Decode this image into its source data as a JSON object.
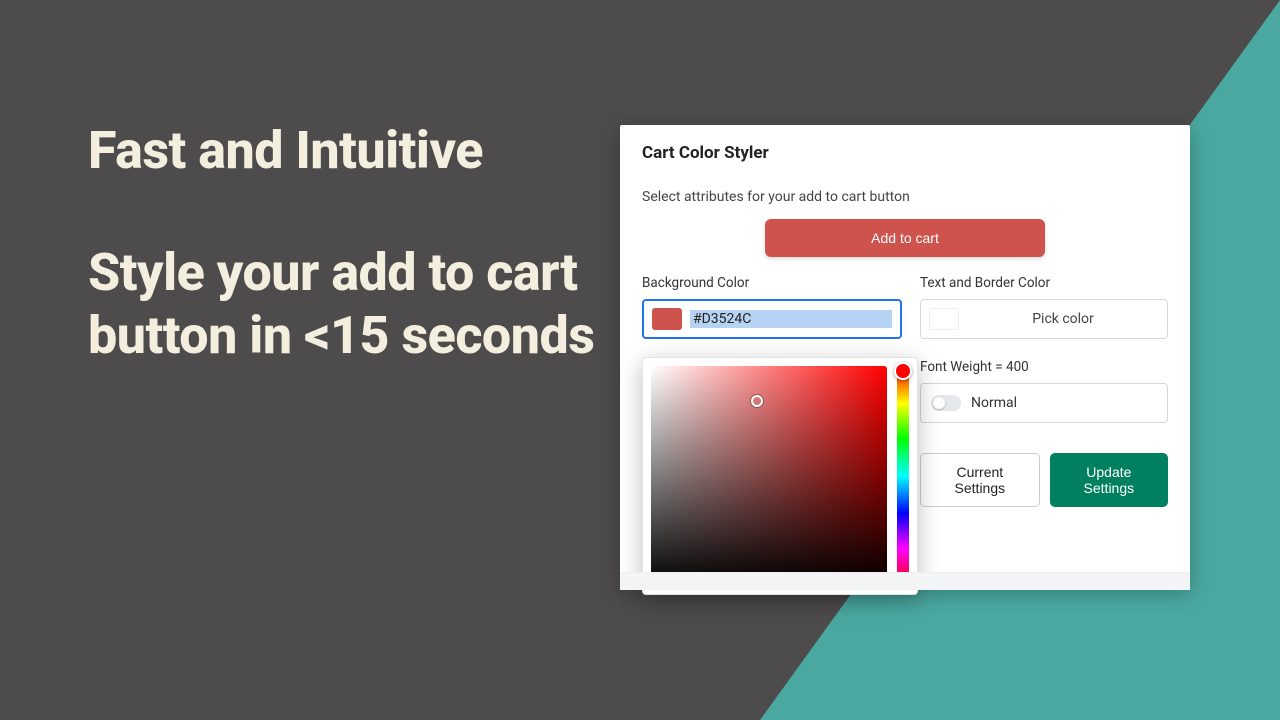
{
  "hero": {
    "line1": "Fast and Intuitive",
    "line2": "Style your add to cart button in <15 seconds"
  },
  "panel": {
    "title": "Cart Color Styler",
    "subtitle": "Select attributes for your add to cart button",
    "add_to_cart_label": "Add to cart",
    "bg_label": "Background Color",
    "bg_value": "#D3524C",
    "text_border_label": "Text and Border Color",
    "pick_color_label": "Pick color",
    "font_weight_label": "Font Weight = 400",
    "font_weight_value": "Normal",
    "current_settings_label": "Current Settings",
    "update_settings_label": "Update Settings"
  },
  "colors": {
    "accent_teal": "#4aa8a0",
    "bg_dark": "#4d4b4b",
    "add_to_cart_bg": "#cf534d",
    "update_btn_bg": "#008060",
    "focus_ring": "#1e73e8"
  }
}
